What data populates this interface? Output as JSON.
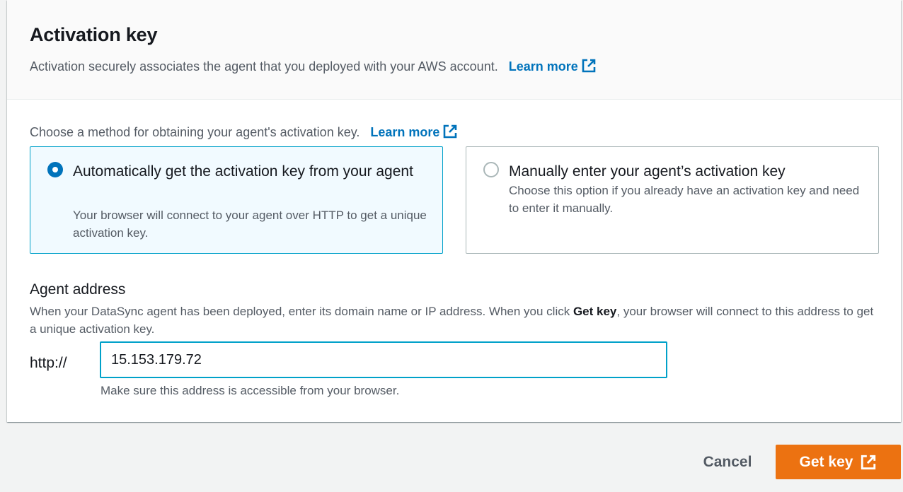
{
  "header": {
    "title": "Activation key",
    "description": "Activation securely associates the agent that you deployed with your AWS account.",
    "learn_more": "Learn more"
  },
  "method": {
    "label": "Choose a method for obtaining your agent's activation key.",
    "learn_more": "Learn more",
    "options": [
      {
        "title": "Automatically get the activation key from your agent",
        "description": "Your browser will connect to your agent over HTTP to get a unique activation key.",
        "selected": true
      },
      {
        "title": "Manually enter your agent’s activation key",
        "description": "Choose this option if you already have an activation key and need to enter it manually.",
        "selected": false
      }
    ]
  },
  "agent_address": {
    "label": "Agent address",
    "desc_before": "When your DataSync agent has been deployed, enter its domain name or IP address. When you click ",
    "desc_bold": "Get key",
    "desc_after": ", your browser will connect to this address to get a unique activation key.",
    "prefix": "http://",
    "value": "15.153.179.72",
    "hint": "Make sure this address is accessible from your browser."
  },
  "footer": {
    "cancel_label": "Cancel",
    "get_key_label": "Get key"
  },
  "colors": {
    "link": "#0073bb",
    "primary_button": "#ec7211",
    "selected_tile_bg": "#f1faff",
    "focus_border": "#00a1c9"
  },
  "icons": {
    "external_link": "external-link-icon"
  }
}
